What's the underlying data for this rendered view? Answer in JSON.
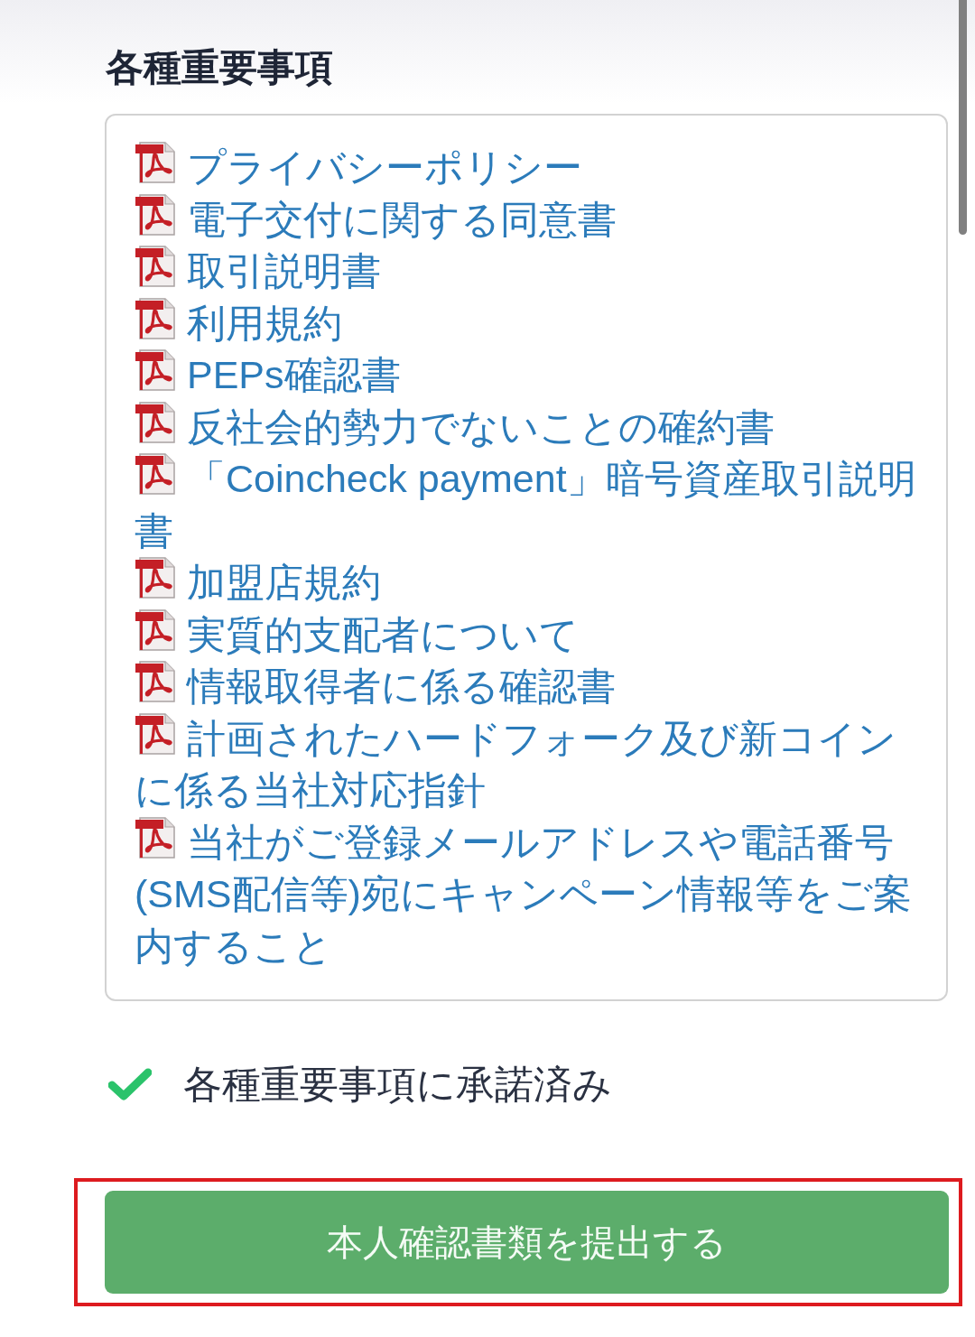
{
  "section": {
    "title": "各種重要事項"
  },
  "documents": [
    {
      "title": "プライバシーポリシー"
    },
    {
      "title": "電子交付に関する同意書"
    },
    {
      "title": "取引説明書"
    },
    {
      "title": "利用規約"
    },
    {
      "title": "PEPs確認書"
    },
    {
      "title": "反社会的勢力でないことの確約書"
    },
    {
      "title": "「Coincheck payment」暗号資産取引説明書"
    },
    {
      "title": "加盟店規約"
    },
    {
      "title": "実質的支配者について"
    },
    {
      "title": "情報取得者に係る確認書"
    },
    {
      "title": "計画されたハードフォーク及び新コインに係る当社対応指針"
    },
    {
      "title": "当社がご登録メールアドレスや電話番号(SMS配信等)宛にキャンペーン情報等をご案内すること"
    }
  ],
  "agreement": {
    "checked": true,
    "label": "各種重要事項に承諾済み"
  },
  "submit_button": {
    "label": "本人確認書類を提出する",
    "highlighted": true
  }
}
